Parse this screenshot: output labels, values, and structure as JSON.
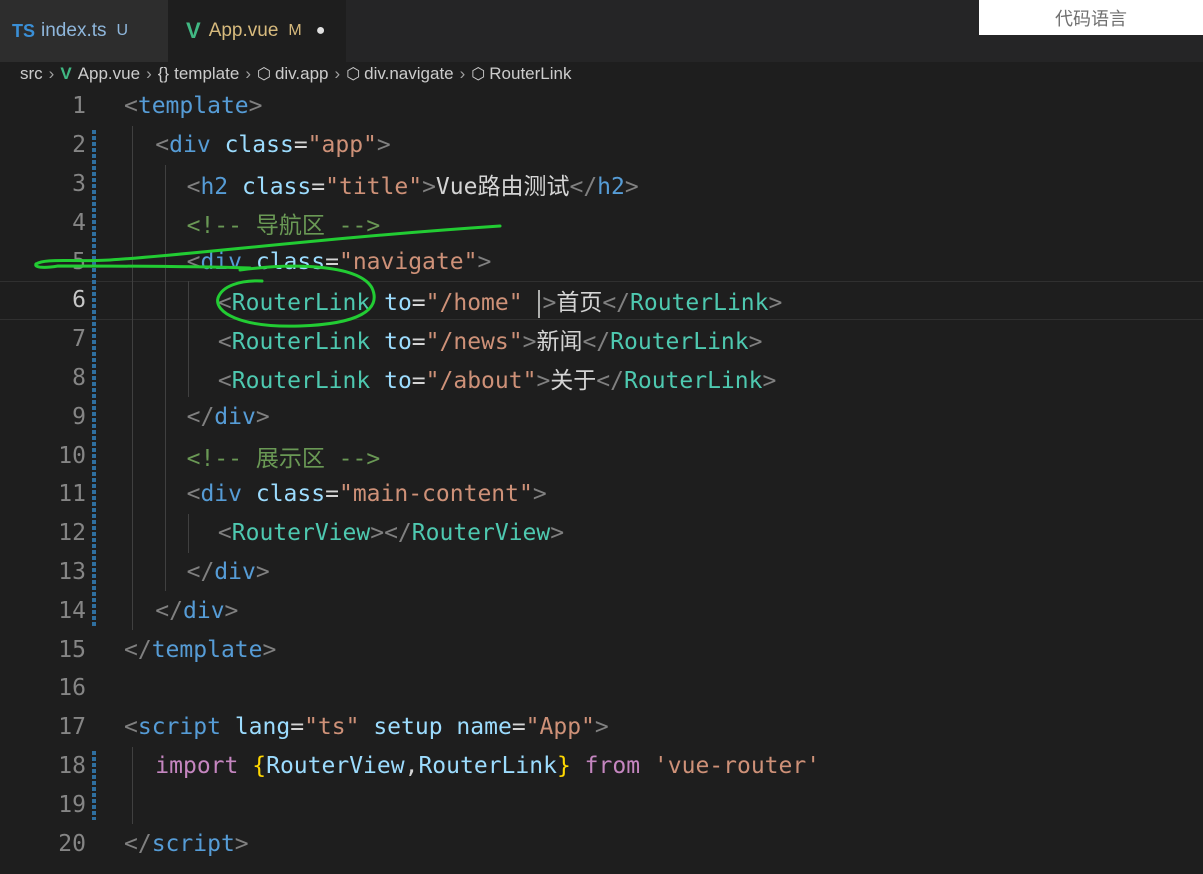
{
  "tabs": [
    {
      "icon": "TS",
      "name": "index.ts",
      "badge": "U"
    },
    {
      "icon": "V",
      "name": "App.vue",
      "badge": "M",
      "dirty": "●"
    }
  ],
  "overlay": {
    "text": "代码语言"
  },
  "breadcrumb": {
    "items": [
      "src",
      "App.vue",
      "template",
      "div.app",
      "div.navigate",
      "RouterLink"
    ]
  },
  "editor": {
    "line_numbers": [
      "1",
      "2",
      "3",
      "4",
      "5",
      "6",
      "7",
      "8",
      "9",
      "10",
      "11",
      "12",
      "13",
      "14",
      "15",
      "16",
      "17",
      "18",
      "19",
      "20"
    ],
    "current_line": "6",
    "lines": [
      [
        [
          "p",
          "<"
        ],
        [
          "t",
          "template"
        ],
        [
          "p",
          ">"
        ]
      ],
      [
        [
          "p",
          "<"
        ],
        [
          "t",
          "div"
        ],
        [
          "w",
          " "
        ],
        [
          "a",
          "class"
        ],
        [
          "w",
          "="
        ],
        [
          "s",
          "\"app\""
        ],
        [
          "p",
          ">"
        ]
      ],
      [
        [
          "p",
          "<"
        ],
        [
          "t",
          "h2"
        ],
        [
          "w",
          " "
        ],
        [
          "a",
          "class"
        ],
        [
          "w",
          "="
        ],
        [
          "s",
          "\"title\""
        ],
        [
          "p",
          ">"
        ],
        [
          "w",
          "Vue路由测试"
        ],
        [
          "p",
          "</"
        ],
        [
          "t",
          "h2"
        ],
        [
          "p",
          ">"
        ]
      ],
      [
        [
          "cm",
          "<!-- 导航区 -->"
        ]
      ],
      [
        [
          "p",
          "<"
        ],
        [
          "t",
          "div"
        ],
        [
          "w",
          " "
        ],
        [
          "a",
          "class"
        ],
        [
          "w",
          "="
        ],
        [
          "s",
          "\"navigate\""
        ],
        [
          "p",
          ">"
        ]
      ],
      [
        [
          "p",
          "<"
        ],
        [
          "c",
          "RouterLink"
        ],
        [
          "w",
          " "
        ],
        [
          "a",
          "to"
        ],
        [
          "w",
          "="
        ],
        [
          "s",
          "\"/home\""
        ],
        [
          "w",
          " "
        ],
        [
          "cursor",
          ""
        ],
        [
          "p",
          ">"
        ],
        [
          "w",
          "首页"
        ],
        [
          "p",
          "</"
        ],
        [
          "c",
          "RouterLink"
        ],
        [
          "p",
          ">"
        ]
      ],
      [
        [
          "p",
          "<"
        ],
        [
          "c",
          "RouterLink"
        ],
        [
          "w",
          " "
        ],
        [
          "a",
          "to"
        ],
        [
          "w",
          "="
        ],
        [
          "s",
          "\"/news\""
        ],
        [
          "p",
          ">"
        ],
        [
          "w",
          "新闻"
        ],
        [
          "p",
          "</"
        ],
        [
          "c",
          "RouterLink"
        ],
        [
          "p",
          ">"
        ]
      ],
      [
        [
          "p",
          "<"
        ],
        [
          "c",
          "RouterLink"
        ],
        [
          "w",
          " "
        ],
        [
          "a",
          "to"
        ],
        [
          "w",
          "="
        ],
        [
          "s",
          "\"/about\""
        ],
        [
          "p",
          ">"
        ],
        [
          "w",
          "关于"
        ],
        [
          "p",
          "</"
        ],
        [
          "c",
          "RouterLink"
        ],
        [
          "p",
          ">"
        ]
      ],
      [
        [
          "p",
          "</"
        ],
        [
          "t",
          "div"
        ],
        [
          "p",
          ">"
        ]
      ],
      [
        [
          "cm",
          "<!-- 展示区 -->"
        ]
      ],
      [
        [
          "p",
          "<"
        ],
        [
          "t",
          "div"
        ],
        [
          "w",
          " "
        ],
        [
          "a",
          "class"
        ],
        [
          "w",
          "="
        ],
        [
          "s",
          "\"main-content\""
        ],
        [
          "p",
          ">"
        ]
      ],
      [
        [
          "p",
          "<"
        ],
        [
          "c",
          "RouterView"
        ],
        [
          "p",
          "></"
        ],
        [
          "c",
          "RouterView"
        ],
        [
          "p",
          ">"
        ]
      ],
      [
        [
          "p",
          "</"
        ],
        [
          "t",
          "div"
        ],
        [
          "p",
          ">"
        ]
      ],
      [
        [
          "p",
          "</"
        ],
        [
          "t",
          "div"
        ],
        [
          "p",
          ">"
        ]
      ],
      [
        [
          "p",
          "</"
        ],
        [
          "t",
          "template"
        ],
        [
          "p",
          ">"
        ]
      ],
      [],
      [
        [
          "p",
          "<"
        ],
        [
          "t",
          "script"
        ],
        [
          "w",
          " "
        ],
        [
          "a",
          "lang"
        ],
        [
          "w",
          "="
        ],
        [
          "s",
          "\"ts\""
        ],
        [
          "w",
          " "
        ],
        [
          "a",
          "setup"
        ],
        [
          "w",
          " "
        ],
        [
          "a",
          "name"
        ],
        [
          "w",
          "="
        ],
        [
          "s",
          "\"App\""
        ],
        [
          "p",
          ">"
        ]
      ],
      [
        [
          "k",
          "import"
        ],
        [
          "w",
          " "
        ],
        [
          "b",
          "{"
        ],
        [
          "a",
          "RouterView"
        ],
        [
          "w",
          ","
        ],
        [
          "a",
          "RouterLink"
        ],
        [
          "b",
          "}"
        ],
        [
          "w",
          " "
        ],
        [
          "k",
          "from"
        ],
        [
          "w",
          " "
        ],
        [
          "s",
          "'vue-router'"
        ]
      ],
      [],
      [
        [
          "p",
          "</"
        ],
        [
          "t",
          "script"
        ],
        [
          "p",
          ">"
        ]
      ]
    ]
  }
}
